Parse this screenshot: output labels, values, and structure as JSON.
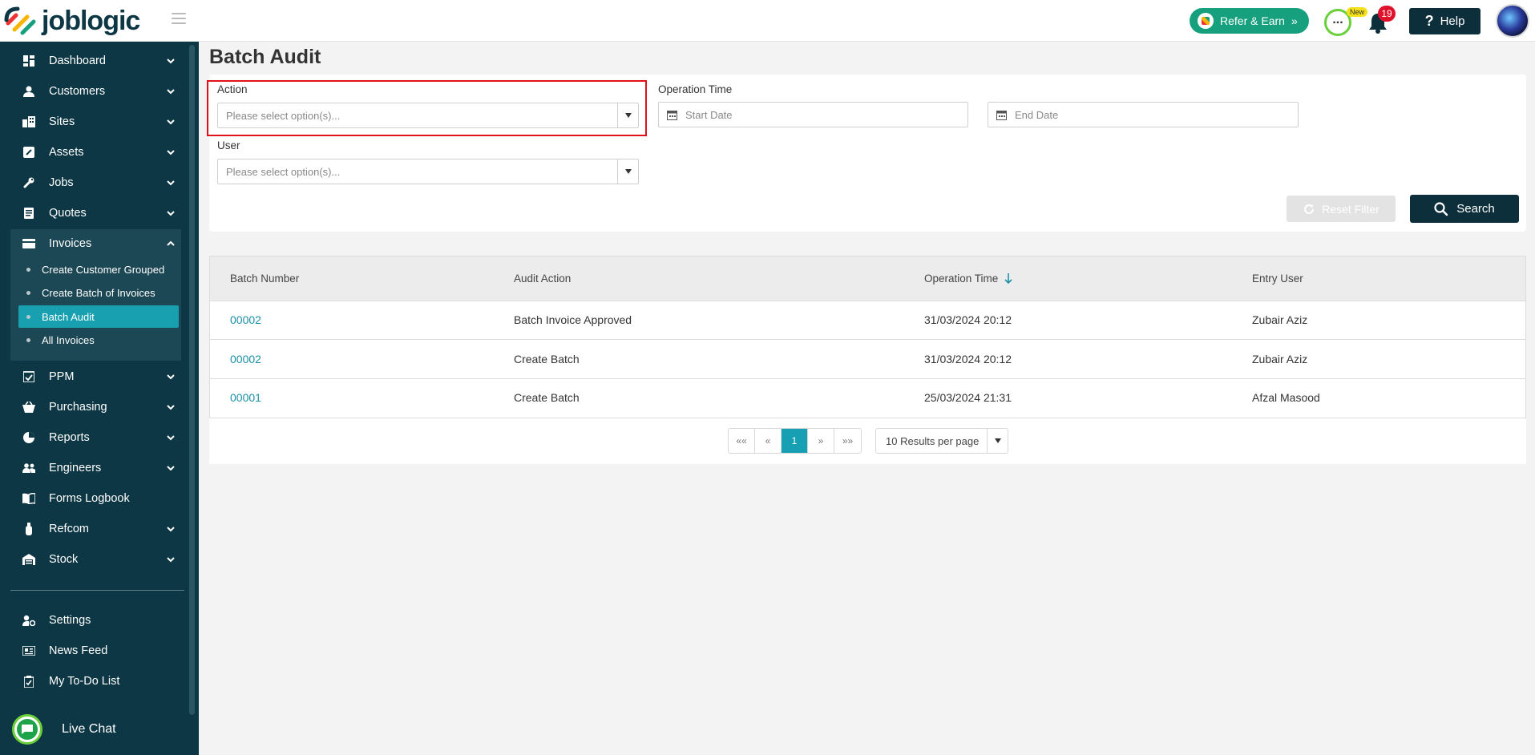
{
  "app": {
    "logo_text": "joblogic"
  },
  "header": {
    "refer_label": "Refer & Earn",
    "refer_arrows": "»",
    "new_badge": "New",
    "notification_count": "19",
    "help_label": "Help",
    "help_symbol": "?"
  },
  "sidebar": {
    "items": [
      {
        "label": "Dashboard"
      },
      {
        "label": "Customers"
      },
      {
        "label": "Sites"
      },
      {
        "label": "Assets"
      },
      {
        "label": "Jobs"
      },
      {
        "label": "Quotes"
      },
      {
        "label": "Invoices"
      },
      {
        "label": "PPM"
      },
      {
        "label": "Purchasing"
      },
      {
        "label": "Reports"
      },
      {
        "label": "Engineers"
      },
      {
        "label": "Forms Logbook"
      },
      {
        "label": "Refcom"
      },
      {
        "label": "Stock"
      }
    ],
    "invoice_sub": [
      {
        "label": "Create Customer Grouped"
      },
      {
        "label": "Create Batch of Invoices"
      },
      {
        "label": "Batch Audit"
      },
      {
        "label": "All Invoices"
      }
    ],
    "bottom": [
      {
        "label": "Settings"
      },
      {
        "label": "News Feed"
      },
      {
        "label": "My To-Do List"
      }
    ],
    "live_chat": "Live Chat"
  },
  "page": {
    "title": "Batch Audit"
  },
  "filters": {
    "action_label": "Action",
    "action_placeholder": "Please select option(s)...",
    "operation_time_label": "Operation Time",
    "start_placeholder": "Start Date",
    "end_placeholder": "End Date",
    "user_label": "User",
    "user_placeholder": "Please select option(s)...",
    "reset_label": "Reset Filter",
    "search_label": "Search"
  },
  "table": {
    "headers": [
      "Batch Number",
      "Audit Action",
      "Operation Time",
      "Entry User"
    ],
    "rows": [
      {
        "batch": "00002",
        "action": "Batch Invoice Approved",
        "time": "31/03/2024 20:12",
        "user": "Zubair Aziz"
      },
      {
        "batch": "00002",
        "action": "Create Batch",
        "time": "31/03/2024 20:12",
        "user": "Zubair Aziz"
      },
      {
        "batch": "00001",
        "action": "Create Batch",
        "time": "25/03/2024 21:31",
        "user": "Afzal Masood"
      }
    ]
  },
  "pagination": {
    "first": "««",
    "prev": "«",
    "current": "1",
    "next": "»",
    "last": "»»",
    "per_page": "10 Results per page"
  }
}
